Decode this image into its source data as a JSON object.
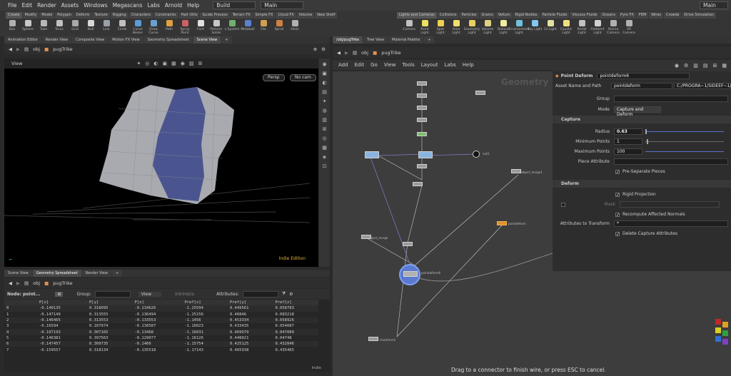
{
  "menubar": {
    "items": [
      "File",
      "Edit",
      "Render",
      "Assets",
      "Windows",
      "Megascans",
      "Labs",
      "Arnold",
      "Help"
    ],
    "build_desk": "Build",
    "main_desk": "Main",
    "right_desk": "Main"
  },
  "shelf_left": {
    "tabs": [
      "Create",
      "Modify",
      "Model",
      "Polygon",
      "Deform",
      "Texture",
      "Rigging",
      "Characters",
      "Constraints",
      "Hair Utils",
      "Guide Process",
      "Terrain FX",
      "Simple FX",
      "Cloud FX",
      "Volume",
      "New Shelf"
    ],
    "tools": [
      {
        "label": "Box",
        "color": "#b0b0b0"
      },
      {
        "label": "Sphere",
        "color": "#c8c8c8"
      },
      {
        "label": "Tube",
        "color": "#b8b8b8"
      },
      {
        "label": "Torus",
        "color": "#c0c0c0"
      },
      {
        "label": "Grid",
        "color": "#a8a8a8"
      },
      {
        "label": "Null",
        "color": "#d8d8d8"
      },
      {
        "label": "Line",
        "color": "#9aa0a8"
      },
      {
        "label": "Circle",
        "color": "#c0c0c0"
      },
      {
        "label": "Curve Bezier",
        "color": "#5a9bd8"
      },
      {
        "label": "Draw Curve",
        "color": "#6aa0d0"
      },
      {
        "label": "Path",
        "color": "#e0a040"
      },
      {
        "label": "Spray Paint",
        "color": "#d06060"
      },
      {
        "label": "Font",
        "color": "#e0e0e0"
      },
      {
        "label": "Platonic Solids",
        "color": "#c8c8c8"
      },
      {
        "label": "L-System",
        "color": "#70b070"
      },
      {
        "label": "Metaball",
        "color": "#5a80d0"
      },
      {
        "label": "File",
        "color": "#d0a050"
      },
      {
        "label": "Spiral",
        "color": "#d08040"
      },
      {
        "label": "Helix",
        "color": "#b0b0b0"
      }
    ]
  },
  "shelf_right": {
    "tabs": [
      "Lights and Cameras",
      "Collisions",
      "Particles",
      "Grains",
      "Vellum",
      "Rigid Bodies",
      "Particle Fluids",
      "Viscous Fluids",
      "Oceans",
      "Pyro FX",
      "FEM",
      "Wires",
      "Crowds",
      "Drive Simulation"
    ],
    "tools": [
      {
        "label": "Camera",
        "color": "#c0c0c0"
      },
      {
        "label": "Point Light",
        "color": "#f0e060"
      },
      {
        "label": "Spot Light",
        "color": "#f0d050"
      },
      {
        "label": "Area Light",
        "color": "#f0e070"
      },
      {
        "label": "Geometry Light",
        "color": "#e8d060"
      },
      {
        "label": "Volume Light",
        "color": "#e0d080"
      },
      {
        "label": "Distant Light",
        "color": "#f0f0a0"
      },
      {
        "label": "Environment Light",
        "color": "#70c0e0"
      },
      {
        "label": "Sky Light",
        "color": "#80c8f0"
      },
      {
        "label": "GI Light",
        "color": "#e0e0a0"
      },
      {
        "label": "Caustic Light",
        "color": "#f0e080"
      },
      {
        "label": "Portal Light",
        "color": "#c0c0c0"
      },
      {
        "label": "Ambient Light",
        "color": "#d0d0d0"
      },
      {
        "label": "Stereo Camera",
        "color": "#b0b0b0"
      },
      {
        "label": "VR Camera",
        "color": "#b0b0b0"
      }
    ]
  },
  "left_top_tabs": [
    "Animation Editor",
    "Render View",
    "Composite View",
    "Motion FX View",
    "Geometry Spreadsheet",
    "Scene View"
  ],
  "path": {
    "root": "obj",
    "node": "pugTrike"
  },
  "viewport": {
    "title": "View",
    "persp": "Persp",
    "cam": "No cam",
    "edition": "Indie Edition"
  },
  "left_bottom_tabs": [
    "Scene View",
    "Geometry Spreadsheet",
    "Render View"
  ],
  "spreadsheet": {
    "node_label": "Node: point...",
    "group_label": "Group:",
    "view_label": "View",
    "intrinsics_label": "Intrinsics",
    "attributes_label": "Attributes:",
    "columns": [
      "",
      "P[x]",
      "P[y]",
      "P[z]",
      "Pref[x]",
      "Pref[y]",
      "Pref[z]"
    ],
    "rows": [
      [
        "0",
        "-0.140135",
        "0.318095",
        "-0.134626",
        "-1.25594",
        "0.449561",
        "0.058783"
      ],
      [
        "1",
        "-0.147149",
        "0.313555",
        "-0.136494",
        "-1.25156",
        "0.46846",
        "0.083218"
      ],
      [
        "2",
        "-0.146465",
        "0.313553",
        "-0.133553",
        "-1.1456",
        "0.453334",
        "0.058926"
      ],
      [
        "3",
        "-0.16594",
        "0.107974",
        "-0.130587",
        "-1.16023",
        "0.433435",
        "0.054087"
      ],
      [
        "4",
        "-0.107193",
        "0.307165",
        "-0.13468",
        "-1.16031",
        "0.469979",
        "0.047089"
      ],
      [
        "5",
        "-0.146381",
        "0.397563",
        "-0.129077",
        "-1.16126",
        "0.448021",
        "0.04748"
      ],
      [
        "6",
        "-0.147457",
        "0.309735",
        "-0.1466",
        "-1.15754",
        "0.425125",
        "0.432846"
      ],
      [
        "7",
        "-0.159557",
        "0.318134",
        "-0.135518",
        "-1.17143",
        "0.465938",
        "0.435465"
      ]
    ],
    "edition": "Indie"
  },
  "right_tabs": [
    "/obj/pugTrike",
    "Tree View",
    "Material Palette"
  ],
  "net_menu": [
    "Add",
    "Edit",
    "Go",
    "View",
    "Tools",
    "Layout",
    "Labs",
    "Help"
  ],
  "network": {
    "watermark": "Geometry",
    "status": "Drag to a connector to finish wire, or press ESC to cancel.",
    "node_labels": [
      "object_merge",
      "object_merge1",
      "pointdeform6",
      "null1",
      "pointdeform",
      "transform1"
    ]
  },
  "params": {
    "node_type": "Point Deform",
    "node_name": "pointdeform6",
    "asset_label": "Asset Name and Path",
    "asset_name": "pointdeform",
    "asset_path": "C:/PROGRA~1/SIDEEF~1/",
    "group_label": "Group",
    "mode_label": "Mode",
    "mode_value": "Capture and Deform",
    "capture_section": "Capture",
    "radius_label": "Radius",
    "radius_value": "0.63",
    "min_points_label": "Minimum Points",
    "min_points_value": "1",
    "max_points_label": "Maximum Points",
    "max_points_value": "100",
    "piece_label": "Piece Attribute",
    "pre_separate": "Pre-Separate Pieces",
    "deform_section": "Deform",
    "rigid": "Rigid Projection",
    "mask_label": "Mask",
    "recompute": "Recompute Affected Normals",
    "attr_label": "Attributes to Transform",
    "attr_value": "*",
    "delete_capture": "Delete Capture Attributes"
  },
  "swatches": [
    "#c0282a",
    "#e0a020",
    "#d8d020",
    "#30a040",
    "#3070d0",
    "#8040c0"
  ]
}
